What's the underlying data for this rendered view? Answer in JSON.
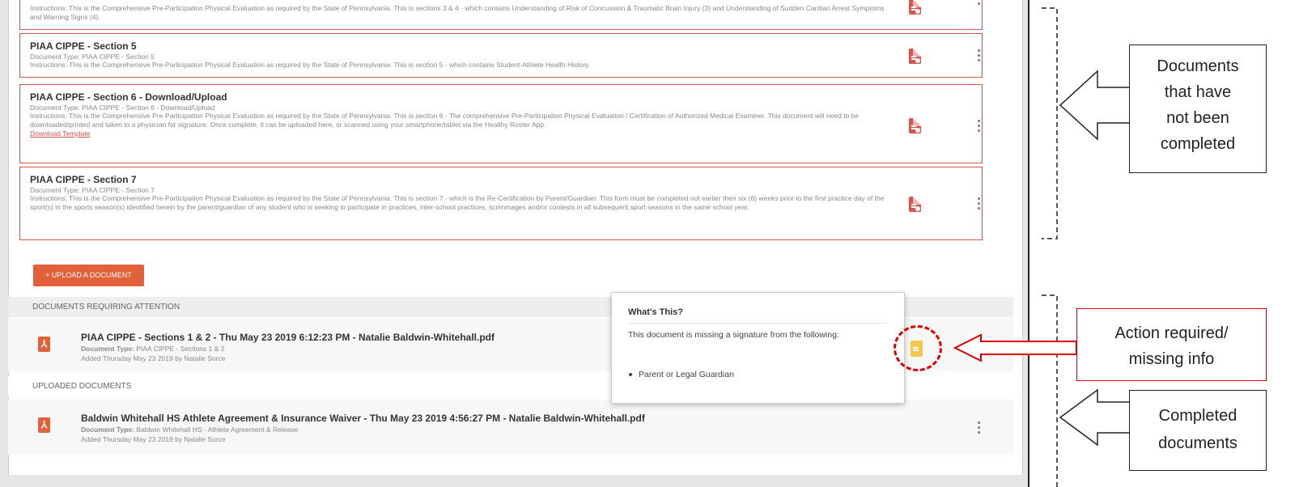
{
  "not_completed": [
    {
      "title": "",
      "type": "",
      "instructions": "Instructions: This is the Comprehensive Pre-Participation Physical Evaluation as required by the State of Pennsylvania. This is sections 3 & 4 - which contains Understanding of Risk of Concussion & Traumatic Brain Injury (3) and Understanding of Sudden Cardian Arrest Symptoms and Warning Signs (4)."
    },
    {
      "title": "PIAA CIPPE - Section 5",
      "type": "Document Type: PIAA CIPPE - Section 5",
      "instructions": "Instructions: This is the Comprehensive Pre-Participation Physical Evaluation as required by the State of Pennsylvania. This is section 5 - which contains Student-Athlete Health History."
    },
    {
      "title": "PIAA CIPPE - Section 6 - Download/Upload",
      "type": "Document Type: PIAA CIPPE - Section 6 - Download/Upload",
      "instructions": "Instructions: This is the Comprehensive Pre-Participation Physical Evaluation as required by the State of Pennsylvania. This is section 6 - The comprehensive Pre-Participation Physical Evaluation / Certification of Authorized Medical Examiner. This document will need to be downloaded/printed and taken to a physician for signature. Once complete, it can be uploaded here, or scanned using your smartphone/tablet via the Healthy Roster App.",
      "link": "Download Template"
    },
    {
      "title": "PIAA CIPPE - Section 7",
      "type": "Document Type: PIAA CIPPE - Section 7",
      "instructions": "Instructions: This is the Comprehensive Pre-Participation Physical Evaluation as required by the State of Pennsylvania. This is section 7 - which is the Re-Certification by Parent/Guardian. This form must be completed not earlier then six (6) weeks prior to the first practice day of the sport(s) in the sports season(s) identified herein by the parent/guardian of any student who is seeking to participate in practices, inter-school practices, scrimmages and/or contests in all subsequent sport seasons in the same school year."
    }
  ],
  "upload_button": "+ UPLOAD A DOCUMENT",
  "attention": {
    "header": "DOCUMENTS REQUIRING ATTENTION",
    "title": "PIAA CIPPE - Sections 1 & 2 - Thu May 23 2019 6:12:23 PM - Natalie Baldwin-Whitehall.pdf",
    "type_label": "Document Type:",
    "type_value": "PIAA CIPPE - Sections 1 & 2",
    "added": "Added Thursday May 23 2019 by Natalie Sorce"
  },
  "uploaded": {
    "header": "UPLOADED DOCUMENTS",
    "title": "Baldwin Whitehall HS Athlete Agreement & Insurance Waiver - Thu May 23 2019 4:56:27 PM - Natalie Baldwin-Whitehall.pdf",
    "type_label": "Document Type:",
    "type_value": "Baldwin Whitehall HS - Athlete Agreement & Release",
    "added": "Added Thursday May 23 2019 by Natalie Sorce"
  },
  "popover": {
    "title": "What's This?",
    "body": "This document is missing a signature from the following:",
    "item": "Parent or Legal Guardian"
  },
  "callouts": {
    "not_completed_lines": [
      "Documents",
      "that have",
      "not been",
      "completed"
    ],
    "action_lines": [
      "Action required/",
      "missing info"
    ],
    "completed_lines": [
      "Completed",
      "documents"
    ]
  },
  "colors": {
    "accent_red": "#d9534f",
    "button_orange": "#e2603a",
    "warning_yellow": "#f2c94c",
    "annotation_red": "#e00000"
  }
}
